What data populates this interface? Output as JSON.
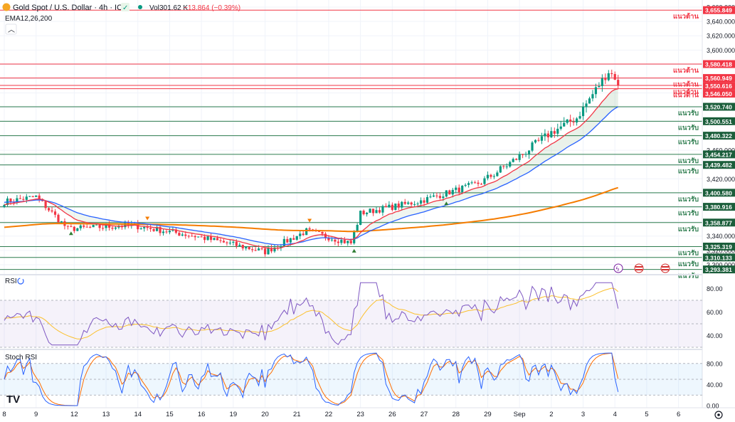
{
  "header": {
    "symbol": "Gold Spot / U.S. Dollar · 4h · ICE",
    "volume_label": "Vol",
    "volume_value": "301.62 K",
    "change": "−13.864 (−0.39%)",
    "indicator": "EMA12,26,200",
    "colors": {
      "down": "#f23645",
      "up": "#089981"
    }
  },
  "price_axis": {
    "ticks": [
      "3,660.000",
      "3,640.000",
      "3,620.000",
      "3,600.000",
      "3,580.000",
      "3,560.000",
      "3,540.000",
      "3,520.000",
      "3,500.000",
      "3,480.000",
      "3,460.000",
      "3,440.000",
      "3,420.000",
      "3,400.000",
      "3,380.000",
      "3,360.000",
      "3,340.000",
      "3,320.000",
      "3,300.000"
    ]
  },
  "levels": [
    {
      "value": 3655.849,
      "label": "3,655.849",
      "type": "resistance",
      "text": "แนวต้าน"
    },
    {
      "value": 3580.418,
      "label": "3,580.418",
      "type": "resistance",
      "text": "แนวต้าน"
    },
    {
      "value": 3560.949,
      "label": "3,560.949",
      "type": "resistance",
      "text": "แนวต้าน"
    },
    {
      "value": 3550.616,
      "label": "3,550.616",
      "type": "resistance",
      "text": "แนวต้าน"
    },
    {
      "value": 3546.05,
      "label": "3,546.050",
      "type": "resistance",
      "text": "แนวต้าน"
    },
    {
      "value": 3520.74,
      "label": "3,520.740",
      "type": "support",
      "text": "แนวรับ"
    },
    {
      "value": 3500.551,
      "label": "3,500.551",
      "type": "support",
      "text": "แนวรับ"
    },
    {
      "value": 3480.322,
      "label": "3,480.322",
      "type": "support",
      "text": "แนวรับ"
    },
    {
      "value": 3454.217,
      "label": "3,454.217",
      "type": "support",
      "text": "แนวรับ"
    },
    {
      "value": 3439.482,
      "label": "3,439.482",
      "type": "support",
      "text": "แนวรับ"
    },
    {
      "value": 3400.58,
      "label": "3,400.580",
      "type": "support",
      "text": "แนวรับ"
    },
    {
      "value": 3380.916,
      "label": "3,380.916",
      "type": "support",
      "text": "แนวรับ"
    },
    {
      "value": 3358.877,
      "label": "3,358.877",
      "type": "support",
      "text": "แนวรับ"
    },
    {
      "value": 3325.319,
      "label": "3,325.319",
      "type": "support",
      "text": "แนวรับ"
    },
    {
      "value": 3310.133,
      "label": "3,310.133",
      "type": "support",
      "text": "แนวรับ"
    },
    {
      "value": 3293.381,
      "label": "3,293.381",
      "type": "support",
      "text": "แนวรับ"
    }
  ],
  "rsi": {
    "label": "RSI",
    "ticks": [
      "80.00",
      "60.00",
      "40.00"
    ]
  },
  "stoch": {
    "label": "Stoch RSI",
    "ticks": [
      "80.00",
      "40.00",
      "0.00"
    ]
  },
  "x_axis": {
    "labels": [
      {
        "i": 0,
        "t": "8"
      },
      {
        "i": 10,
        "t": "9"
      },
      {
        "i": 22,
        "t": "12"
      },
      {
        "i": 32,
        "t": "13"
      },
      {
        "i": 42,
        "t": "14"
      },
      {
        "i": 52,
        "t": "15"
      },
      {
        "i": 62,
        "t": "16"
      },
      {
        "i": 72,
        "t": "19"
      },
      {
        "i": 82,
        "t": "20"
      },
      {
        "i": 92,
        "t": "21"
      },
      {
        "i": 102,
        "t": "22"
      },
      {
        "i": 112,
        "t": "23"
      },
      {
        "i": 122,
        "t": "26"
      },
      {
        "i": 132,
        "t": "27"
      },
      {
        "i": 142,
        "t": "28"
      },
      {
        "i": 152,
        "t": "29"
      },
      {
        "i": 162,
        "t": "Sep"
      },
      {
        "i": 172,
        "t": "2"
      },
      {
        "i": 182,
        "t": "3"
      },
      {
        "i": 192,
        "t": "4"
      },
      {
        "i": 202,
        "t": "5"
      },
      {
        "i": 212,
        "t": "6"
      }
    ]
  },
  "chart_data": {
    "type": "candlestick",
    "title": "Gold Spot / U.S. Dollar · 4h · ICE",
    "timeframe": "4h",
    "ylim": [
      3290,
      3665
    ],
    "rsi_ylim": [
      30,
      90
    ],
    "stoch_ylim": [
      0,
      100
    ],
    "key_points": [
      {
        "bar": 0,
        "close": 3388
      },
      {
        "bar": 10,
        "close": 3395
      },
      {
        "bar": 20,
        "close": 3350
      },
      {
        "bar": 40,
        "close": 3355
      },
      {
        "bar": 60,
        "close": 3340
      },
      {
        "bar": 82,
        "close": 3318
      },
      {
        "bar": 95,
        "close": 3347
      },
      {
        "bar": 109,
        "close": 3330
      },
      {
        "bar": 112,
        "close": 3372
      },
      {
        "bar": 130,
        "close": 3388
      },
      {
        "bar": 150,
        "close": 3415
      },
      {
        "bar": 160,
        "close": 3445
      },
      {
        "bar": 172,
        "close": 3485
      },
      {
        "bar": 180,
        "close": 3505
      },
      {
        "bar": 186,
        "close": 3545
      },
      {
        "bar": 190,
        "close": 3570
      },
      {
        "bar": 192,
        "close": 3562
      },
      {
        "bar": 193,
        "close": 3548
      }
    ],
    "series": [
      {
        "name": "EMA12",
        "color": "#f23645"
      },
      {
        "name": "EMA26",
        "color": "#2962ff"
      },
      {
        "name": "EMA200",
        "color": "#f57c00"
      }
    ]
  }
}
